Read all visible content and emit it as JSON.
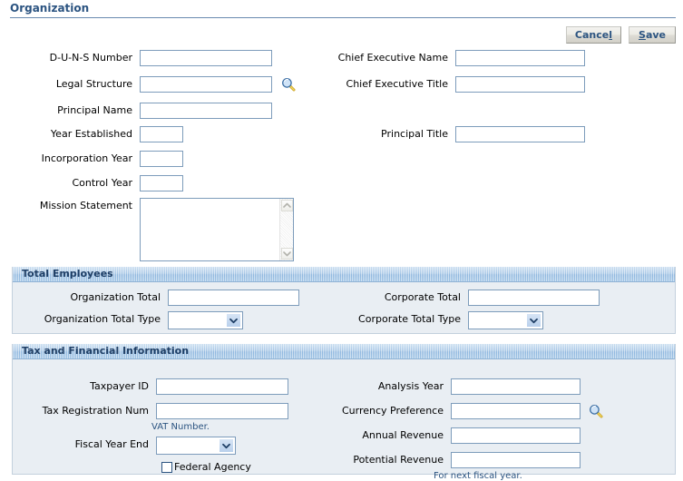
{
  "page": {
    "title": "Organization"
  },
  "actions": {
    "cancel": {
      "pre": "Cance",
      "key": "l",
      "post": ""
    },
    "save": {
      "pre": "",
      "key": "S",
      "post": "ave"
    },
    "cancel_label": "Cancel",
    "save_label": "Save"
  },
  "organization": {
    "fields": {
      "duns_number": {
        "label": "D-U-N-S Number",
        "value": ""
      },
      "legal_structure": {
        "label": "Legal Structure",
        "value": ""
      },
      "principal_name": {
        "label": "Principal Name",
        "value": ""
      },
      "year_established": {
        "label": "Year Established",
        "value": ""
      },
      "incorporation_year": {
        "label": "Incorporation Year",
        "value": ""
      },
      "control_year": {
        "label": "Control Year",
        "value": ""
      },
      "mission_statement": {
        "label": "Mission Statement",
        "value": ""
      },
      "chief_executive_name": {
        "label": "Chief Executive Name",
        "value": ""
      },
      "chief_executive_title": {
        "label": "Chief Executive Title",
        "value": ""
      },
      "principal_title": {
        "label": "Principal Title",
        "value": ""
      }
    }
  },
  "total_employees": {
    "header": "Total Employees",
    "fields": {
      "organization_total": {
        "label": "Organization Total",
        "value": ""
      },
      "organization_total_type": {
        "label": "Organization Total Type",
        "value": ""
      },
      "corporate_total": {
        "label": "Corporate Total",
        "value": ""
      },
      "corporate_total_type": {
        "label": "Corporate Total Type",
        "value": ""
      }
    }
  },
  "tax_financial": {
    "header": "Tax and Financial Information",
    "fields": {
      "taxpayer_id": {
        "label": "Taxpayer ID",
        "value": ""
      },
      "tax_registration_num": {
        "label": "Tax Registration Num",
        "value": "",
        "hint": "VAT Number."
      },
      "fiscal_year_end": {
        "label": "Fiscal Year End",
        "value": ""
      },
      "federal_agency": {
        "label": "Federal Agency",
        "checked": false
      },
      "analysis_year": {
        "label": "Analysis Year",
        "value": ""
      },
      "currency_preference": {
        "label": "Currency Preference",
        "value": ""
      },
      "annual_revenue": {
        "label": "Annual Revenue",
        "value": ""
      },
      "potential_revenue": {
        "label": "Potential Revenue",
        "value": "",
        "hint": "For next fiscal year."
      }
    }
  },
  "icons": {
    "lov_legal_structure": "search-lov-icon",
    "lov_currency_preference": "search-lov-icon",
    "dropdown": "chevron-down-icon",
    "scroll_up": "chevron-up-icon",
    "scroll_down": "chevron-down-icon"
  },
  "colors": {
    "title": "#2c5481",
    "section_header_text": "#1f3f66",
    "section_bg": "#e9eef3",
    "field_border": "#7d9cbb",
    "hint_text": "#2c5481"
  }
}
